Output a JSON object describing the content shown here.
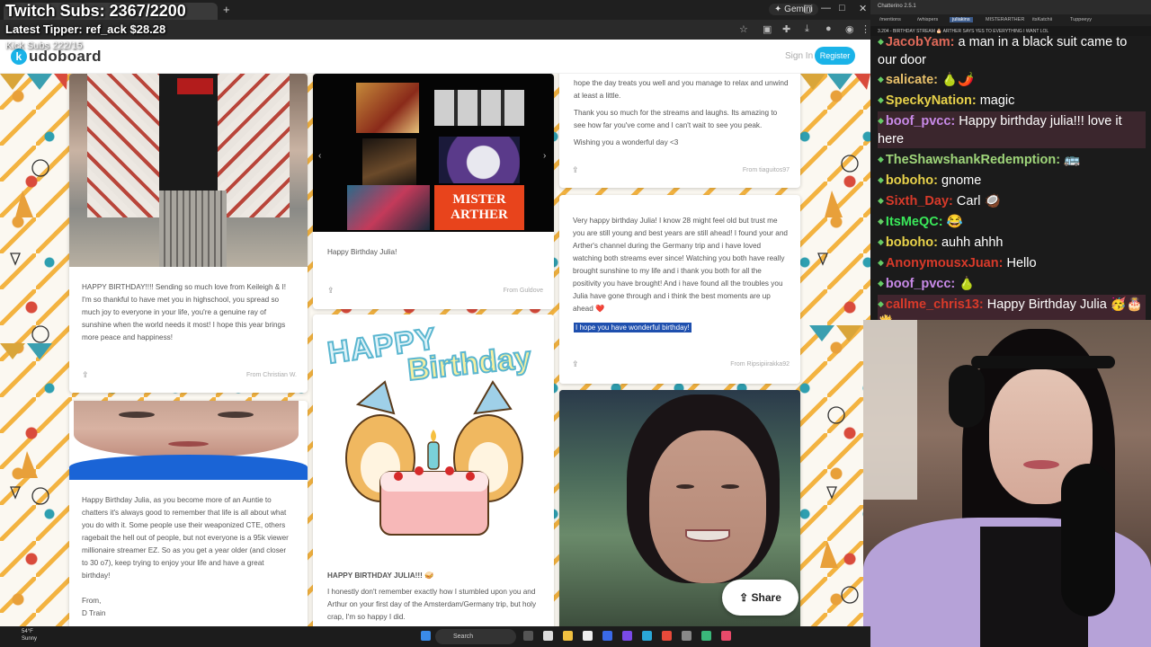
{
  "overlay": {
    "subs": "Twitch Subs: 2367/2200",
    "tipper": "Latest Tipper: ref_ack  $28.28",
    "kick": "Kick Subs 222/15"
  },
  "browser": {
    "tab_title": "",
    "gemini": "Gemini"
  },
  "kudoboard": {
    "logo": "udoboard",
    "signin": "Sign In",
    "register": "Register"
  },
  "cards": {
    "c1": {
      "text": "HAPPY BIRTHDAY!!!! Sending so much love from Keileigh & I! I'm so thankful to have met you in highschool, you spread so much joy to everyone in your life, you're a genuine ray of sunshine when the world needs it most! I hope this year brings more peace and happiness!",
      "from": "From Christian W."
    },
    "c2": {
      "text": "Happy Birthday Julia, as you become more of an Auntie to chatters it's always good to remember that life is all about what you do with it. Some people use their weaponized CTE, others ragebait the hell out of people, but not everyone is a 95k viewer millionaire streamer EZ. So as you get a year older (and closer to 30 o7), keep trying to enjoy your life and have a great birthday!",
      "sig1": "From,",
      "sig2": "D Train"
    },
    "c3": {
      "text": "Happy Birthday Julia!",
      "from": "From Guldove",
      "mister": "MISTER",
      "arther": "ARTHER"
    },
    "c4": {
      "art1": "HAPPY",
      "art2": "Birthday",
      "title": "HAPPY BIRTHDAY JULIA!!! 🥪",
      "text": "I honestly don't remember exactly how I stumbled upon you and Arthur on your first day of the Amsterdam/Germany trip, but holy crap, I'm so happy I did."
    },
    "c5": {
      "text1": "hope the day treats you well and you manage to relax and unwind at least a little.",
      "text2": "Thank you so much for the streams and laughs. Its amazing to see how far you've come and I can't wait to see you peak.",
      "text3": "Wishing you a wonderful day <3",
      "from": "From tiaguitos97"
    },
    "c6": {
      "text": "Very happy birthday Julia! I know 28 might feel old but trust me you are still young and best years are still ahead! I found your and Arther's channel during the Germany trip and i have loved watching both streams ever since! Watching you both have really brought sunshine to my life and i thank you both for all the positivity you have brought! And i have found all the troubles you Julia have gone through and i think the best moments are up ahead ❤️",
      "highlight": "I hope you have wonderful birthday!",
      "from": "From Ripsipiirakka92"
    }
  },
  "share": "Share",
  "chat": {
    "app": "Chatterino 2.5.1",
    "tabs": [
      "/mentions",
      "/whispers",
      "juliakins",
      "MISTERARTHER",
      "itsKatchii",
      "Tuppeeyy"
    ],
    "header": "3.204 - BIRTHDAY STREAM 🎂 ARTHER SAYS YES TO EVERYTHING I WANT LOL",
    "messages": [
      {
        "user": "JacobYam:",
        "text": "a man in a black suit came to our door",
        "color": "#e06a5a"
      },
      {
        "user": "salicate:",
        "text": "🍐🌶️",
        "color": "#e8c06a"
      },
      {
        "user": "SpeckyNation:",
        "text": "magic",
        "color": "#e8d24a"
      },
      {
        "user": "boof_pvcc:",
        "text": "Happy birthday julia!!! love it here",
        "color": "#c88ae8"
      },
      {
        "user": "TheShawshankRedemption:",
        "text": "🚌",
        "color": "#9fd67a"
      },
      {
        "user": "boboho:",
        "text": "gnome",
        "color": "#e8d24a"
      },
      {
        "user": "Sixth_Day:",
        "text": "Carl 🥥",
        "color": "#d83a2a"
      },
      {
        "user": "ItsMeQC:",
        "text": "😂",
        "color": "#3ae85a"
      },
      {
        "user": "boboho:",
        "text": "auhh ahhh",
        "color": "#e8d24a"
      },
      {
        "user": "AnonymousxJuan:",
        "text": "Hello",
        "color": "#d83a2a"
      },
      {
        "user": "boof_pvcc:",
        "text": "🍐",
        "color": "#c88ae8"
      },
      {
        "user": "callme_chris13:",
        "text": "Happy Birthday Julia 🥳🎂🍟",
        "color": "#d83a2a"
      }
    ]
  },
  "taskbar": {
    "temp": "54°F",
    "weather": "Sunny",
    "search": "Search"
  }
}
